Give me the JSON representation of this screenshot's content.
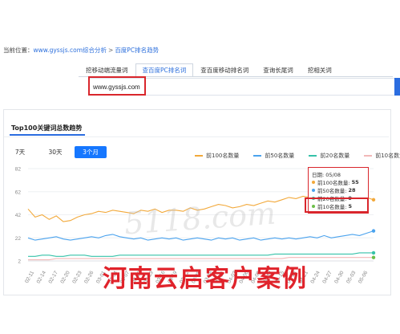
{
  "breadcrumb": {
    "prefix": "当前位置：",
    "site": "www.gyssjs.com综合分析",
    "separator": ">",
    "current": "百度PC排名趋势"
  },
  "tabs": [
    {
      "label": "挖移动端流量词",
      "active": false
    },
    {
      "label": "查百度PC排名词",
      "active": true
    },
    {
      "label": "查百度移动排名词",
      "active": false
    },
    {
      "label": "查询长尾词",
      "active": false
    },
    {
      "label": "挖相关词",
      "active": false
    }
  ],
  "search": {
    "value": "www.gyssjs.com"
  },
  "card": {
    "title": "Top100关键词总数趋势"
  },
  "range_buttons": [
    {
      "label": "7天",
      "active": false
    },
    {
      "label": "30天",
      "active": false
    },
    {
      "label": "3个月",
      "active": true
    }
  ],
  "colors": {
    "accent": "#1677ff",
    "highlight": "#d9262c",
    "top100": "#f2a93b",
    "top50": "#4ba3ee",
    "top20": "#36c2a9",
    "top10": "#f2b8b8"
  },
  "chart_data": {
    "type": "line",
    "title": "",
    "y_ticks": [
      2,
      22,
      42,
      62,
      82
    ],
    "ylim": [
      2,
      82
    ],
    "x_labels": [
      "02-11",
      "02-14",
      "02-17",
      "02-20",
      "02-23",
      "02-26",
      "03-01",
      "03-04",
      "03-07",
      "03-10",
      "03-13",
      "03-16",
      "03-19",
      "03-22",
      "03-25",
      "03-28",
      "03-31",
      "04-03",
      "04-06",
      "04-09",
      "04-12",
      "04-15",
      "04-18",
      "04-21",
      "04-24",
      "04-27",
      "04-30",
      "05-03",
      "05-06"
    ],
    "grid": true,
    "legend_position": "top-right",
    "series": [
      {
        "name": "前100名数量",
        "color": "#f2a93b",
        "values": [
          47,
          40,
          42,
          38,
          41,
          36,
          37,
          40,
          42,
          43,
          45,
          44,
          46,
          45,
          44,
          43,
          46,
          45,
          47,
          44,
          46,
          46,
          45,
          48,
          46,
          47,
          49,
          51,
          50,
          48,
          49,
          51,
          50,
          52,
          54,
          53,
          55,
          57,
          56,
          58,
          57,
          59,
          61,
          60,
          62,
          63,
          61,
          58,
          57,
          55
        ]
      },
      {
        "name": "前50名数量",
        "color": "#4ba3ee",
        "values": [
          22,
          20,
          21,
          22,
          23,
          21,
          20,
          21,
          22,
          23,
          22,
          24,
          25,
          23,
          22,
          21,
          22,
          20,
          21,
          22,
          21,
          22,
          20,
          21,
          22,
          21,
          20,
          22,
          21,
          22,
          20,
          21,
          22,
          20,
          21,
          22,
          21,
          22,
          21,
          22,
          23,
          22,
          24,
          22,
          23,
          24,
          25,
          24,
          26,
          28
        ]
      },
      {
        "name": "前20名数量",
        "color": "#36c2a9",
        "values": [
          6,
          6,
          7,
          7,
          6,
          6,
          7,
          7,
          7,
          6,
          6,
          6,
          6,
          7,
          7,
          7,
          7,
          7,
          7,
          7,
          7,
          7,
          7,
          7,
          7,
          7,
          7,
          7,
          7,
          7,
          7,
          7,
          7,
          7,
          7,
          8,
          8,
          8,
          8,
          8,
          8,
          8,
          8,
          8,
          8,
          8,
          8,
          9,
          9,
          9
        ]
      },
      {
        "name": "前10名数量",
        "color": "#f2b8b8",
        "values": [
          3,
          3,
          3,
          3,
          4,
          4,
          4,
          4,
          4,
          4,
          4,
          4,
          4,
          4,
          4,
          4,
          4,
          4,
          4,
          4,
          4,
          4,
          4,
          4,
          4,
          4,
          4,
          4,
          4,
          4,
          4,
          4,
          4,
          4,
          4,
          4,
          4,
          5,
          5,
          5,
          5,
          5,
          5,
          5,
          5,
          5,
          5,
          5,
          5,
          5
        ]
      }
    ]
  },
  "tooltip": {
    "date": "日期: 05/08",
    "rows": [
      {
        "label": "前100名数量:",
        "value": "55",
        "color": "#f2a93b"
      },
      {
        "label": "前50名数量:",
        "value": "28",
        "color": "#4ba3ee"
      },
      {
        "label": "前20名数量:",
        "value": "9",
        "color": "#36c2a9"
      },
      {
        "label": "前10名数量:",
        "value": "5",
        "color": "#6cc04a"
      }
    ]
  },
  "watermark": "5118.com",
  "caption": "河南云启客户案例"
}
